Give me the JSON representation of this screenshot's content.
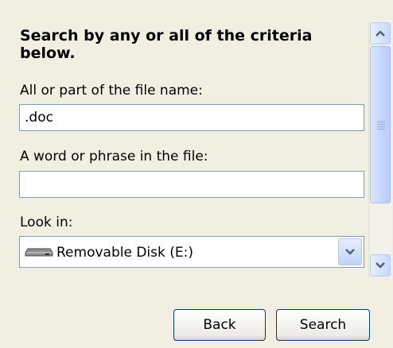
{
  "search_pane": {
    "heading": "Search by any or all of the criteria below.",
    "filename_label": "All or part of the file name:",
    "filename_value": ".doc",
    "phrase_label": "A word or phrase in the file:",
    "phrase_value": "",
    "look_in_label": "Look in:",
    "look_in_value": "Removable Disk (E:)",
    "look_in_icon": "removable-disk-icon"
  },
  "buttons": {
    "back": "Back",
    "search": "Search"
  },
  "colors": {
    "panel_bg": "#f1efe2",
    "field_border": "#7f9db9",
    "button_border": "#003c74",
    "scroll_accent": "#c1d3fb"
  }
}
